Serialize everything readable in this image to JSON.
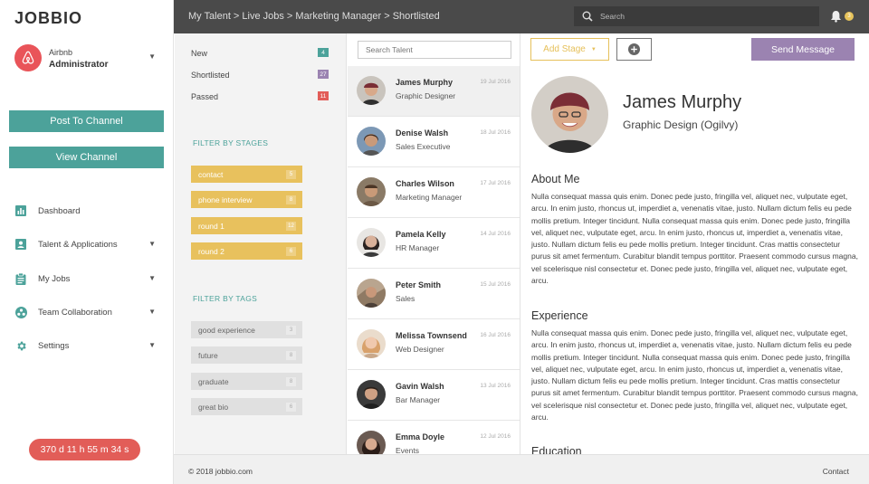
{
  "app": {
    "logo": "JOBBIO"
  },
  "account": {
    "company": "Airbnb",
    "role": "Administrator"
  },
  "sidebar": {
    "post_button": "Post To Channel",
    "view_button": "View Channel",
    "items": [
      {
        "label": "Dashboard",
        "icon": "bar-chart-icon"
      },
      {
        "label": "Talent & Applications",
        "icon": "id-card-icon"
      },
      {
        "label": "My Jobs",
        "icon": "clipboard-icon"
      },
      {
        "label": "Team Collaboration",
        "icon": "team-icon"
      },
      {
        "label": "Settings",
        "icon": "gear-icon"
      }
    ],
    "timer": "370 d 11 h 55 m 34 s"
  },
  "header": {
    "breadcrumb": "My Talent > Live Jobs > Marketing Manager > Shortlisted",
    "search_placeholder": "Search",
    "notification_count": "3"
  },
  "filters": {
    "statuses": [
      {
        "label": "New",
        "count": "4",
        "color": "#4ca29a"
      },
      {
        "label": "Shortlisted",
        "count": "27",
        "color": "#9b83b1"
      },
      {
        "label": "Passed",
        "count": "11",
        "color": "#e25d58"
      }
    ],
    "stages_heading": "FILTER BY STAGES",
    "stages": [
      {
        "label": "contact",
        "count": "5"
      },
      {
        "label": "phone interview",
        "count": "8"
      },
      {
        "label": "round 1",
        "count": "12"
      },
      {
        "label": "round 2",
        "count": "6"
      }
    ],
    "tags_heading": "FILTER BY TAGS",
    "tags": [
      {
        "label": "good experience",
        "count": "3"
      },
      {
        "label": "future",
        "count": "8"
      },
      {
        "label": "graduate",
        "count": "8"
      },
      {
        "label": "great bio",
        "count": "6"
      }
    ]
  },
  "talent_list": {
    "search_placeholder": "Search Talent",
    "items": [
      {
        "name": "James Murphy",
        "role": "Graphic Designer",
        "date": "19 Jul 2016"
      },
      {
        "name": "Denise Walsh",
        "role": "Sales Executive",
        "date": "18 Jul 2016"
      },
      {
        "name": "Charles Wilson",
        "role": "Marketing Manager",
        "date": "17 Jul 2016"
      },
      {
        "name": "Pamela Kelly",
        "role": "HR Manager",
        "date": "14 Jul 2016"
      },
      {
        "name": "Peter Smith",
        "role": "Sales",
        "date": "15 Jul 2016"
      },
      {
        "name": "Melissa Townsend",
        "role": "Web Designer",
        "date": "16 Jul 2016"
      },
      {
        "name": "Gavin Walsh",
        "role": "Bar Manager",
        "date": "13 Jul 2016"
      },
      {
        "name": "Emma Doyle",
        "role": "Events",
        "date": "12 Jul 2016"
      }
    ]
  },
  "profile": {
    "add_stage": "Add Stage",
    "send_message": "Send Message",
    "name": "James Murphy",
    "title": "Graphic Design (Ogilvy)",
    "about_heading": "About Me",
    "about_text": "Nulla consequat massa quis enim. Donec pede justo, fringilla vel, aliquet nec, vulputate eget, arcu. In enim justo, rhoncus ut, imperdiet a, venenatis vitae, justo. Nullam dictum felis eu pede mollis pretium. Integer tincidunt. Nulla consequat massa quis enim. Donec pede justo, fringilla vel, aliquet nec, vulputate eget, arcu. In enim justo, rhoncus ut, imperdiet a, venenatis vitae, justo. Nullam dictum felis eu pede mollis pretium. Integer tincidunt. Cras mattis consectetur purus sit amet fermentum. Curabitur blandit tempus porttitor. Praesent commodo cursus magna, vel scelerisque nisl consectetur et. Donec pede justo, fringilla vel, aliquet nec, vulputate eget, arcu.",
    "experience_heading": "Experience",
    "experience_text": "Nulla consequat massa quis enim. Donec pede justo, fringilla vel, aliquet nec, vulputate eget, arcu. In enim justo, rhoncus ut, imperdiet a, venenatis vitae, justo. Nullam dictum felis eu pede mollis pretium. Integer tincidunt. Nulla consequat massa quis enim. Donec pede justo, fringilla vel, aliquet nec, vulputate eget, arcu. In enim justo, rhoncus ut, imperdiet a, venenatis vitae, justo. Nullam dictum felis eu pede mollis pretium. Integer tincidunt. Cras mattis consectetur purus sit amet fermentum. Curabitur blandit tempus porttitor. Praesent commodo cursus magna, vel scelerisque nisl consectetur et. Donec pede justo, fringilla vel, aliquet nec, vulputate eget, arcu.",
    "education_heading": "Education"
  },
  "footer": {
    "copyright": "© 2018 jobbio.com",
    "contact": "Contact"
  }
}
